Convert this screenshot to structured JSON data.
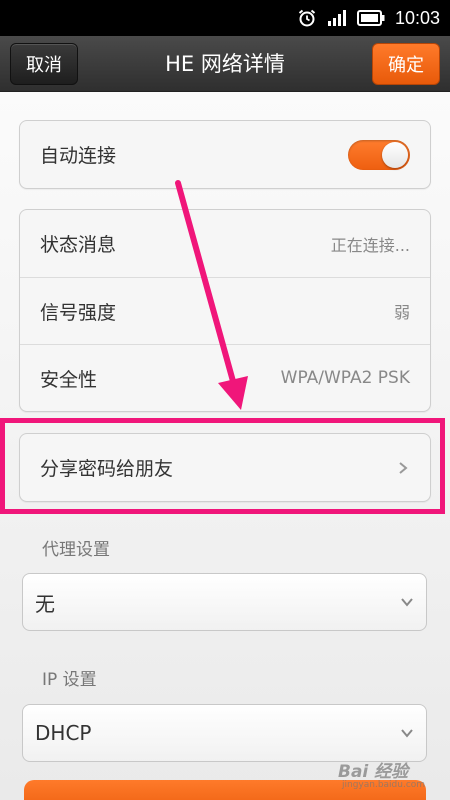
{
  "status_bar": {
    "time": "10:03",
    "icons": [
      "alarm-icon",
      "signal-icon",
      "battery-icon"
    ]
  },
  "header": {
    "title": "HE 网络详情",
    "cancel_label": "取消",
    "confirm_label": "确定"
  },
  "auto_connect": {
    "label": "自动连接",
    "enabled": true
  },
  "info": {
    "items": [
      {
        "label": "状态消息",
        "value": "正在连接..."
      },
      {
        "label": "信号强度",
        "value": "弱"
      },
      {
        "label": "安全性",
        "value": "WPA/WPA2 PSK"
      }
    ]
  },
  "share": {
    "label": "分享密码给朋友"
  },
  "proxy": {
    "section_label": "代理设置",
    "selected": "无"
  },
  "ip": {
    "section_label": "IP 设置",
    "selected": "DHCP"
  },
  "colors": {
    "accent": "#ef6314",
    "annotation": "#f0167a"
  },
  "watermark": {
    "text": "Bai 经验",
    "sub": "jingyan.baidu.com"
  }
}
